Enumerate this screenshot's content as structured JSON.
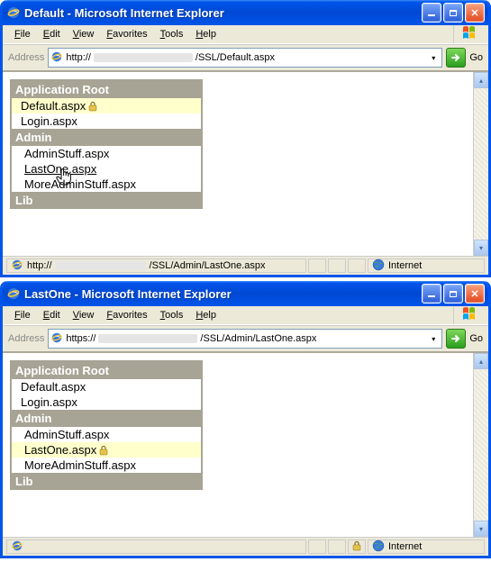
{
  "windows": [
    {
      "title": "Default - Microsoft Internet Explorer",
      "menu": [
        "File",
        "Edit",
        "View",
        "Favorites",
        "Tools",
        "Help"
      ],
      "address_label": "Address",
      "url_prefix": "http://",
      "url_blurred_width": 110,
      "url_suffix": "/SSL/Default.aspx",
      "go_label": "Go",
      "tree": {
        "root_label": "Application Root",
        "items": [
          {
            "label": "Default.aspx",
            "highlight": true,
            "lock": true
          },
          {
            "label": "Login.aspx"
          }
        ],
        "admin_label": "Admin",
        "admin_items": [
          {
            "label": "AdminStuff.aspx"
          },
          {
            "label": "LastOne.aspx",
            "hover": true
          },
          {
            "label": "MoreAdminStuff.aspx"
          }
        ],
        "lib_label": "Lib"
      },
      "status_text_prefix": "http://",
      "status_blurred_width": 100,
      "status_text_suffix": "/SSL/Admin/LastOne.aspx",
      "status_zone": "Internet",
      "show_status_lock": false,
      "show_cursor": true
    },
    {
      "title": "LastOne - Microsoft Internet Explorer",
      "menu": [
        "File",
        "Edit",
        "View",
        "Favorites",
        "Tools",
        "Help"
      ],
      "address_label": "Address",
      "url_prefix": "https://",
      "url_blurred_width": 110,
      "url_suffix": "/SSL/Admin/LastOne.aspx",
      "go_label": "Go",
      "tree": {
        "root_label": "Application Root",
        "items": [
          {
            "label": "Default.aspx"
          },
          {
            "label": "Login.aspx"
          }
        ],
        "admin_label": "Admin",
        "admin_items": [
          {
            "label": "AdminStuff.aspx"
          },
          {
            "label": "LastOne.aspx",
            "highlight": true,
            "lock": true
          },
          {
            "label": "MoreAdminStuff.aspx"
          }
        ],
        "lib_label": "Lib"
      },
      "status_text_prefix": "",
      "status_blurred_width": 0,
      "status_text_suffix": "",
      "status_zone": "Internet",
      "show_status_lock": true,
      "show_cursor": false
    }
  ]
}
